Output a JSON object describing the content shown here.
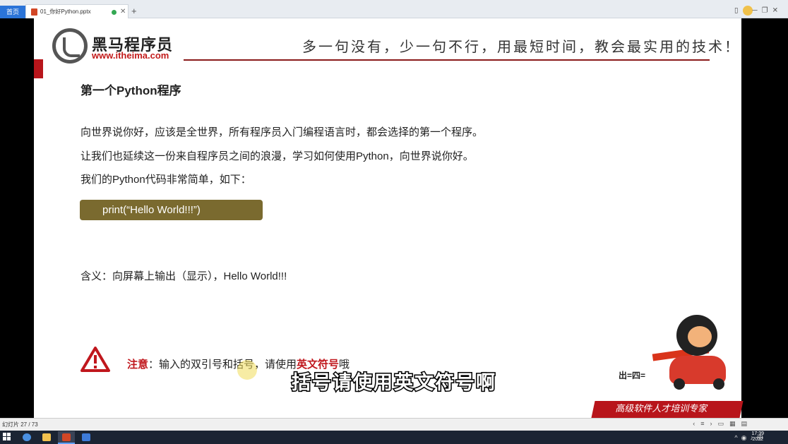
{
  "browser": {
    "home_tab": "首页",
    "file_tab": "01_你好Python.pptx",
    "new_tab_icon": "plus-icon",
    "close_icon": "close-icon"
  },
  "slide": {
    "logo_name": "黑马程序员",
    "logo_url": "www.itheima.com",
    "slogan": "多一句没有，少一句不行，用最短时间，教会最实用的技术！",
    "title": "第一个Python程序",
    "lines": [
      "向世界说你好，应该是全世界，所有程序员入门编程语言时，都会选择的第一个程序。",
      "让我们也延续这一份来自程序员之间的浪漫，学习如何使用Python，向世界说你好。",
      "我们的Python代码非常简单，如下："
    ],
    "code": "print(“Hello World!!!”)",
    "meaning": "含义：向屏幕上输出（显示），Hello World!!!",
    "note_label": "注意",
    "note_pre": "：输入的双引号和括号，请使用",
    "note_emph": "英文符号",
    "note_post": "哦",
    "banner": "高级软件人才培训专家",
    "mascot_sign": "出=四="
  },
  "subtitle": "括号请使用英文符号啊",
  "status": {
    "slide_counter": "幻灯片 27 / 73"
  },
  "taskbar": {
    "ime": "中",
    "time": "17:39",
    "date": "2022"
  },
  "colors": {
    "accent_red": "#b8151b",
    "code_bg": "#7a6a2f",
    "tab_blue": "#2b74d8"
  }
}
